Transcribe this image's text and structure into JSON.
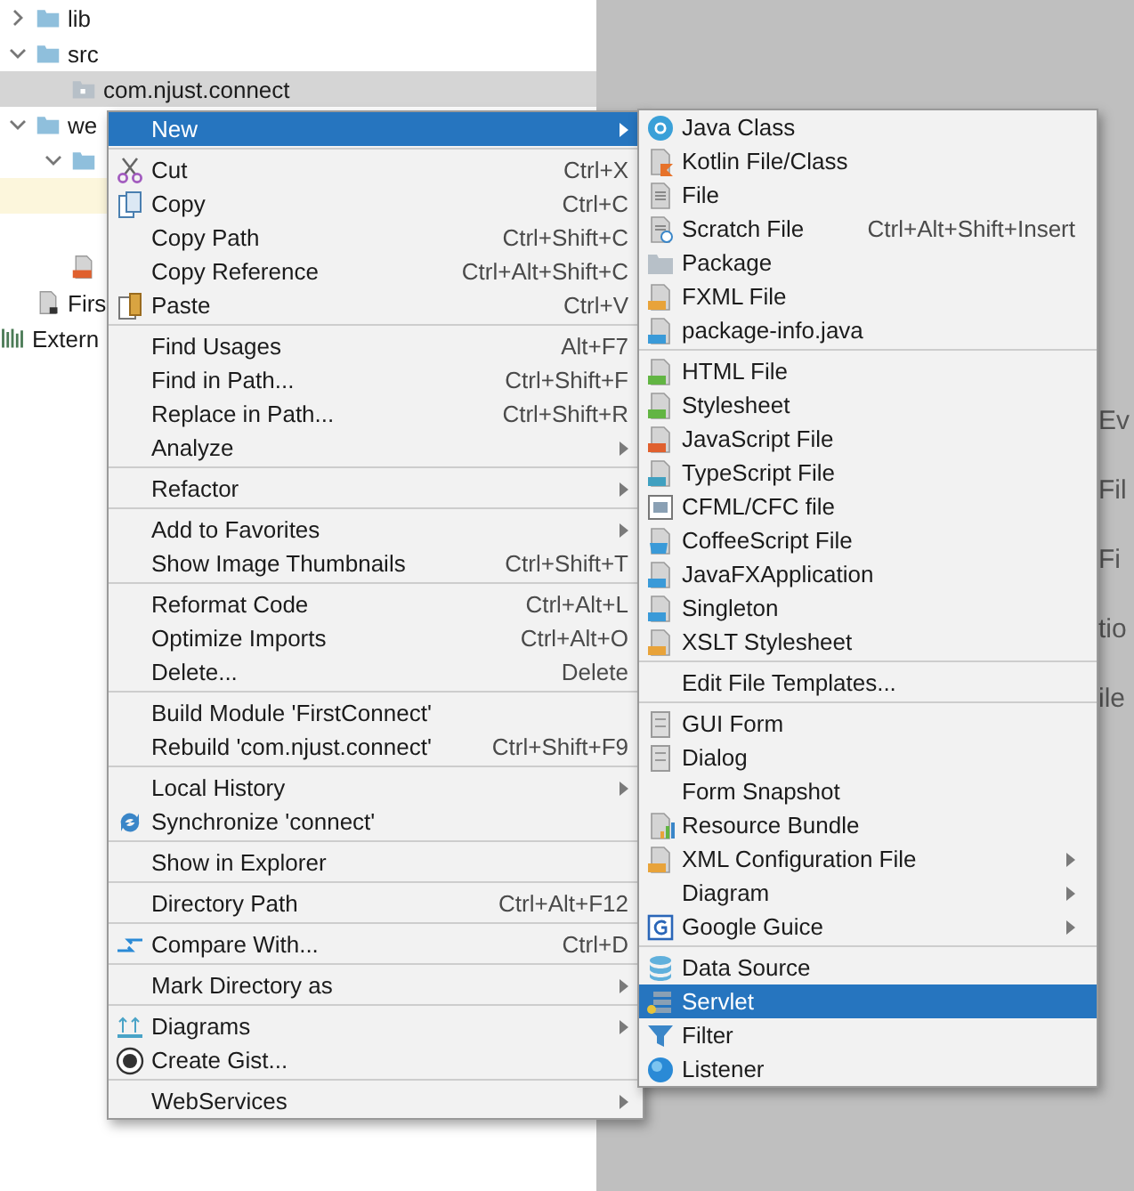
{
  "project_tree": {
    "items": [
      {
        "kind": "folder",
        "label": "lib",
        "expanded": false,
        "selected": false,
        "highlighted": false
      },
      {
        "kind": "folder",
        "label": "src",
        "expanded": true,
        "selected": false,
        "highlighted": false,
        "children": [
          {
            "kind": "package",
            "label": "com.njust.connect",
            "selected": true,
            "highlighted": false
          }
        ]
      },
      {
        "kind": "folder",
        "label": "we",
        "expanded": true,
        "selected": false,
        "highlighted": false,
        "children": [
          {
            "kind": "folder",
            "expanded": true,
            "selected": false,
            "highlighted": false,
            "children": [
              {
                "selected": false,
                "highlighted": true
              },
              {
                "selected": false,
                "highlighted": false
              }
            ]
          },
          {
            "kind": "jsp",
            "selected": false,
            "highlighted": false
          }
        ]
      },
      {
        "kind": "module-file",
        "label": "Firs",
        "selected": false,
        "highlighted": false
      },
      {
        "kind": "library",
        "label": "Extern",
        "selected": false,
        "highlighted": false
      }
    ]
  },
  "background_texts": [
    "Ev",
    "Fil",
    "Fi",
    "tio",
    "ile"
  ],
  "context_menu": {
    "items": [
      {
        "kind": "item",
        "label": "New",
        "selected": true,
        "submenu": true
      },
      {
        "kind": "separator"
      },
      {
        "kind": "item",
        "label": "Cut",
        "shortcut": "Ctrl+X",
        "selected": false,
        "submenu": false
      },
      {
        "kind": "item",
        "label": "Copy",
        "shortcut": "Ctrl+C",
        "selected": false,
        "submenu": false
      },
      {
        "kind": "item",
        "label": "Copy Path",
        "shortcut": "Ctrl+Shift+C",
        "selected": false,
        "submenu": false
      },
      {
        "kind": "item",
        "label": "Copy Reference",
        "shortcut": "Ctrl+Alt+Shift+C",
        "selected": false,
        "submenu": false
      },
      {
        "kind": "item",
        "label": "Paste",
        "shortcut": "Ctrl+V",
        "selected": false,
        "submenu": false
      },
      {
        "kind": "separator"
      },
      {
        "kind": "item",
        "label": "Find Usages",
        "shortcut": "Alt+F7",
        "selected": false,
        "submenu": false
      },
      {
        "kind": "item",
        "label": "Find in Path...",
        "shortcut": "Ctrl+Shift+F",
        "selected": false,
        "submenu": false
      },
      {
        "kind": "item",
        "label": "Replace in Path...",
        "shortcut": "Ctrl+Shift+R",
        "selected": false,
        "submenu": false
      },
      {
        "kind": "item",
        "label": "Analyze",
        "selected": false,
        "submenu": true
      },
      {
        "kind": "separator"
      },
      {
        "kind": "item",
        "label": "Refactor",
        "selected": false,
        "submenu": true
      },
      {
        "kind": "separator"
      },
      {
        "kind": "item",
        "label": "Add to Favorites",
        "selected": false,
        "submenu": true
      },
      {
        "kind": "item",
        "label": "Show Image Thumbnails",
        "shortcut": "Ctrl+Shift+T",
        "selected": false,
        "submenu": false
      },
      {
        "kind": "separator"
      },
      {
        "kind": "item",
        "label": "Reformat Code",
        "shortcut": "Ctrl+Alt+L",
        "selected": false,
        "submenu": false
      },
      {
        "kind": "item",
        "label": "Optimize Imports",
        "shortcut": "Ctrl+Alt+O",
        "selected": false,
        "submenu": false
      },
      {
        "kind": "item",
        "label": "Delete...",
        "shortcut": "Delete",
        "selected": false,
        "submenu": false
      },
      {
        "kind": "separator"
      },
      {
        "kind": "item",
        "label": "Build Module 'FirstConnect'",
        "selected": false,
        "submenu": false
      },
      {
        "kind": "item",
        "label": "Rebuild 'com.njust.connect'",
        "shortcut": "Ctrl+Shift+F9",
        "selected": false,
        "submenu": false
      },
      {
        "kind": "separator"
      },
      {
        "kind": "item",
        "label": "Local History",
        "selected": false,
        "submenu": true
      },
      {
        "kind": "item",
        "label": "Synchronize 'connect'",
        "selected": false,
        "submenu": false
      },
      {
        "kind": "separator"
      },
      {
        "kind": "item",
        "label": "Show in Explorer",
        "selected": false,
        "submenu": false
      },
      {
        "kind": "separator"
      },
      {
        "kind": "item",
        "label": "Directory Path",
        "shortcut": "Ctrl+Alt+F12",
        "selected": false,
        "submenu": false
      },
      {
        "kind": "separator"
      },
      {
        "kind": "item",
        "label": "Compare With...",
        "shortcut": "Ctrl+D",
        "selected": false,
        "submenu": false
      },
      {
        "kind": "separator"
      },
      {
        "kind": "item",
        "label": "Mark Directory as",
        "selected": false,
        "submenu": true
      },
      {
        "kind": "separator"
      },
      {
        "kind": "item",
        "label": "Diagrams",
        "selected": false,
        "submenu": true
      },
      {
        "kind": "item",
        "label": "Create Gist...",
        "selected": false,
        "submenu": false
      },
      {
        "kind": "separator"
      },
      {
        "kind": "item",
        "label": "WebServices",
        "selected": false,
        "submenu": true
      }
    ]
  },
  "new_submenu": {
    "items": [
      {
        "kind": "item",
        "label": "Java Class",
        "selected": false,
        "submenu": false
      },
      {
        "kind": "item",
        "label": "Kotlin File/Class",
        "selected": false,
        "submenu": false
      },
      {
        "kind": "item",
        "label": "File",
        "selected": false,
        "submenu": false
      },
      {
        "kind": "item",
        "label": "Scratch File",
        "shortcut": "Ctrl+Alt+Shift+Insert",
        "selected": false,
        "submenu": false
      },
      {
        "kind": "item",
        "label": "Package",
        "selected": false,
        "submenu": false
      },
      {
        "kind": "item",
        "label": "FXML File",
        "selected": false,
        "submenu": false
      },
      {
        "kind": "item",
        "label": "package-info.java",
        "selected": false,
        "submenu": false
      },
      {
        "kind": "separator"
      },
      {
        "kind": "item",
        "label": "HTML File",
        "selected": false,
        "submenu": false
      },
      {
        "kind": "item",
        "label": "Stylesheet",
        "selected": false,
        "submenu": false
      },
      {
        "kind": "item",
        "label": "JavaScript File",
        "selected": false,
        "submenu": false
      },
      {
        "kind": "item",
        "label": "TypeScript File",
        "selected": false,
        "submenu": false
      },
      {
        "kind": "item",
        "label": "CFML/CFC file",
        "selected": false,
        "submenu": false
      },
      {
        "kind": "item",
        "label": "CoffeeScript File",
        "selected": false,
        "submenu": false
      },
      {
        "kind": "item",
        "label": "JavaFXApplication",
        "selected": false,
        "submenu": false
      },
      {
        "kind": "item",
        "label": "Singleton",
        "selected": false,
        "submenu": false
      },
      {
        "kind": "item",
        "label": "XSLT Stylesheet",
        "selected": false,
        "submenu": false
      },
      {
        "kind": "separator"
      },
      {
        "kind": "item",
        "label": "Edit File Templates...",
        "selected": false,
        "submenu": false
      },
      {
        "kind": "separator"
      },
      {
        "kind": "item",
        "label": "GUI Form",
        "selected": false,
        "submenu": false
      },
      {
        "kind": "item",
        "label": "Dialog",
        "selected": false,
        "submenu": false
      },
      {
        "kind": "item",
        "label": "Form Snapshot",
        "selected": false,
        "submenu": false
      },
      {
        "kind": "item",
        "label": "Resource Bundle",
        "selected": false,
        "submenu": false
      },
      {
        "kind": "item",
        "label": "XML Configuration File",
        "selected": false,
        "submenu": true
      },
      {
        "kind": "item",
        "label": "Diagram",
        "selected": false,
        "submenu": true
      },
      {
        "kind": "item",
        "label": "Google Guice",
        "selected": false,
        "submenu": true
      },
      {
        "kind": "separator"
      },
      {
        "kind": "item",
        "label": "Data Source",
        "selected": false,
        "submenu": false
      },
      {
        "kind": "item",
        "label": "Servlet",
        "selected": true,
        "submenu": false
      },
      {
        "kind": "item",
        "label": "Filter",
        "selected": false,
        "submenu": false
      },
      {
        "kind": "item",
        "label": "Listener",
        "selected": false,
        "submenu": false
      }
    ]
  }
}
